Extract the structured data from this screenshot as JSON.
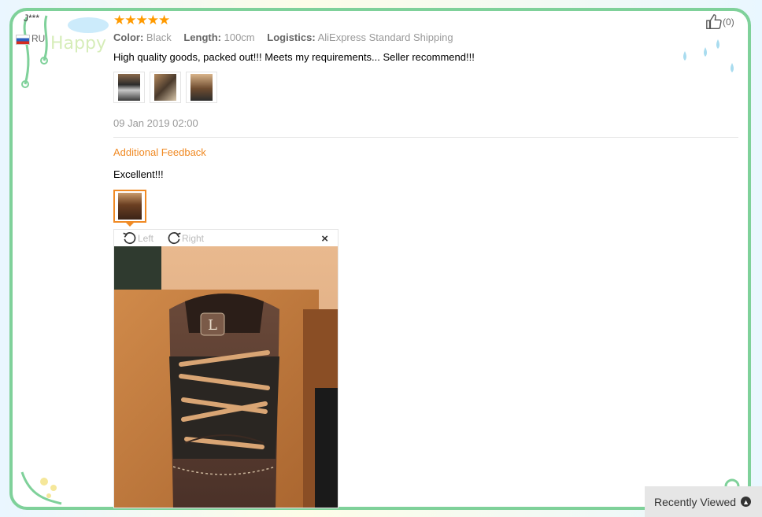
{
  "review": {
    "user_mask": "J***",
    "country": "RU",
    "stars": "★★★★★",
    "attrs": [
      {
        "label": "Color:",
        "value": "Black"
      },
      {
        "label": "Length:",
        "value": "100cm"
      },
      {
        "label": "Logistics:",
        "value": "AliExpress Standard Shipping"
      }
    ],
    "text": "High quality goods, packed out!!! Meets my requirements... Seller recommend!!!",
    "date": "09 Jan 2019 02:00",
    "like_count": "0"
  },
  "additional": {
    "heading": "Additional Feedback",
    "text": "Excellent!!!"
  },
  "viewer": {
    "rotate_left": "Left",
    "rotate_right": "Right",
    "close": "×"
  },
  "decor": {
    "watermark": "Happy"
  },
  "recently_viewed": {
    "label": "Recently Viewed"
  },
  "colors": {
    "star": "#ff9a00",
    "accent": "#f08a24",
    "frame": "#7fd19a"
  }
}
